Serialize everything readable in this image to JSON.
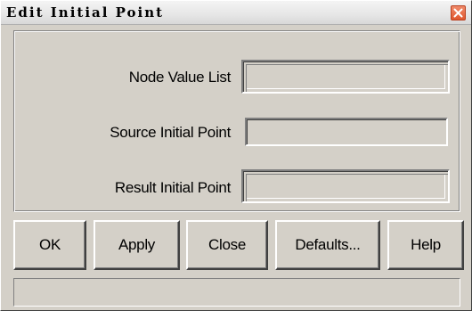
{
  "window": {
    "title": "Edit Initial Point"
  },
  "form": {
    "node_value_list_label": "Node Value List",
    "node_value_list_value": "",
    "source_initial_point_label": "Source Initial Point",
    "source_initial_point_value": "",
    "result_initial_point_label": "Result Initial Point",
    "result_initial_point_value": ""
  },
  "buttons": {
    "ok": "OK",
    "apply": "Apply",
    "close": "Close",
    "defaults": "Defaults...",
    "help": "Help"
  },
  "status": {
    "text": ""
  },
  "colors": {
    "dialog_face": "#d4d0c8",
    "close_button": "#e0562e"
  }
}
